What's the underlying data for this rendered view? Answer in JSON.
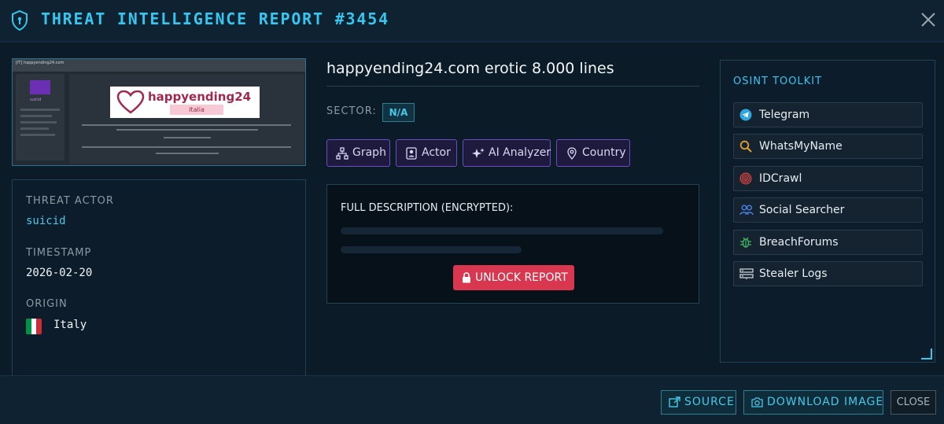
{
  "header": {
    "title": "THREAT INTELLIGENCE REPORT #3454"
  },
  "thumbnail": {
    "url_text": "[IT] happyending24.com",
    "username": "suicid",
    "brand": "happyending24",
    "brand_sub": "Italia"
  },
  "actor_panel": {
    "actor_label": "THREAT ACTOR",
    "actor_value": "suicid",
    "timestamp_label": "TIMESTAMP",
    "timestamp_value": "2026-02-20",
    "origin_label": "ORIGIN",
    "origin_value": "Italy",
    "flag_colors": [
      "#009246",
      "#ffffff",
      "#ce2b37"
    ]
  },
  "report": {
    "title": "happyending24.com erotic 8.000 lines",
    "sector_label": "SECTOR:",
    "sector_value": "N/A"
  },
  "actions": [
    {
      "label": "Graph",
      "icon": "graph-icon"
    },
    {
      "label": "Actor",
      "icon": "actor-icon"
    },
    {
      "label": "AI Analyzer",
      "icon": "sparkle-icon"
    },
    {
      "label": "Country",
      "icon": "map-pin-icon"
    }
  ],
  "description": {
    "heading": "FULL DESCRIPTION (ENCRYPTED):",
    "unlock_label": "UNLOCK REPORT"
  },
  "osint": {
    "title": "OSINT TOOLKIT",
    "tools": [
      {
        "label": "Telegram",
        "icon": "telegram-icon"
      },
      {
        "label": "WhatsMyName",
        "icon": "search-icon"
      },
      {
        "label": "IDCrawl",
        "icon": "fingerprint-icon"
      },
      {
        "label": "Social Searcher",
        "icon": "users-icon"
      },
      {
        "label": "BreachForums",
        "icon": "bug-icon"
      },
      {
        "label": "Stealer Logs",
        "icon": "server-icon"
      }
    ]
  },
  "footer": {
    "source_label": "SOURCE",
    "download_label": "DOWNLOAD IMAGE",
    "close_label": "CLOSE"
  },
  "colors": {
    "accent": "#35c7f0",
    "danger": "#d9364f",
    "purple": "#6e4bc2"
  }
}
